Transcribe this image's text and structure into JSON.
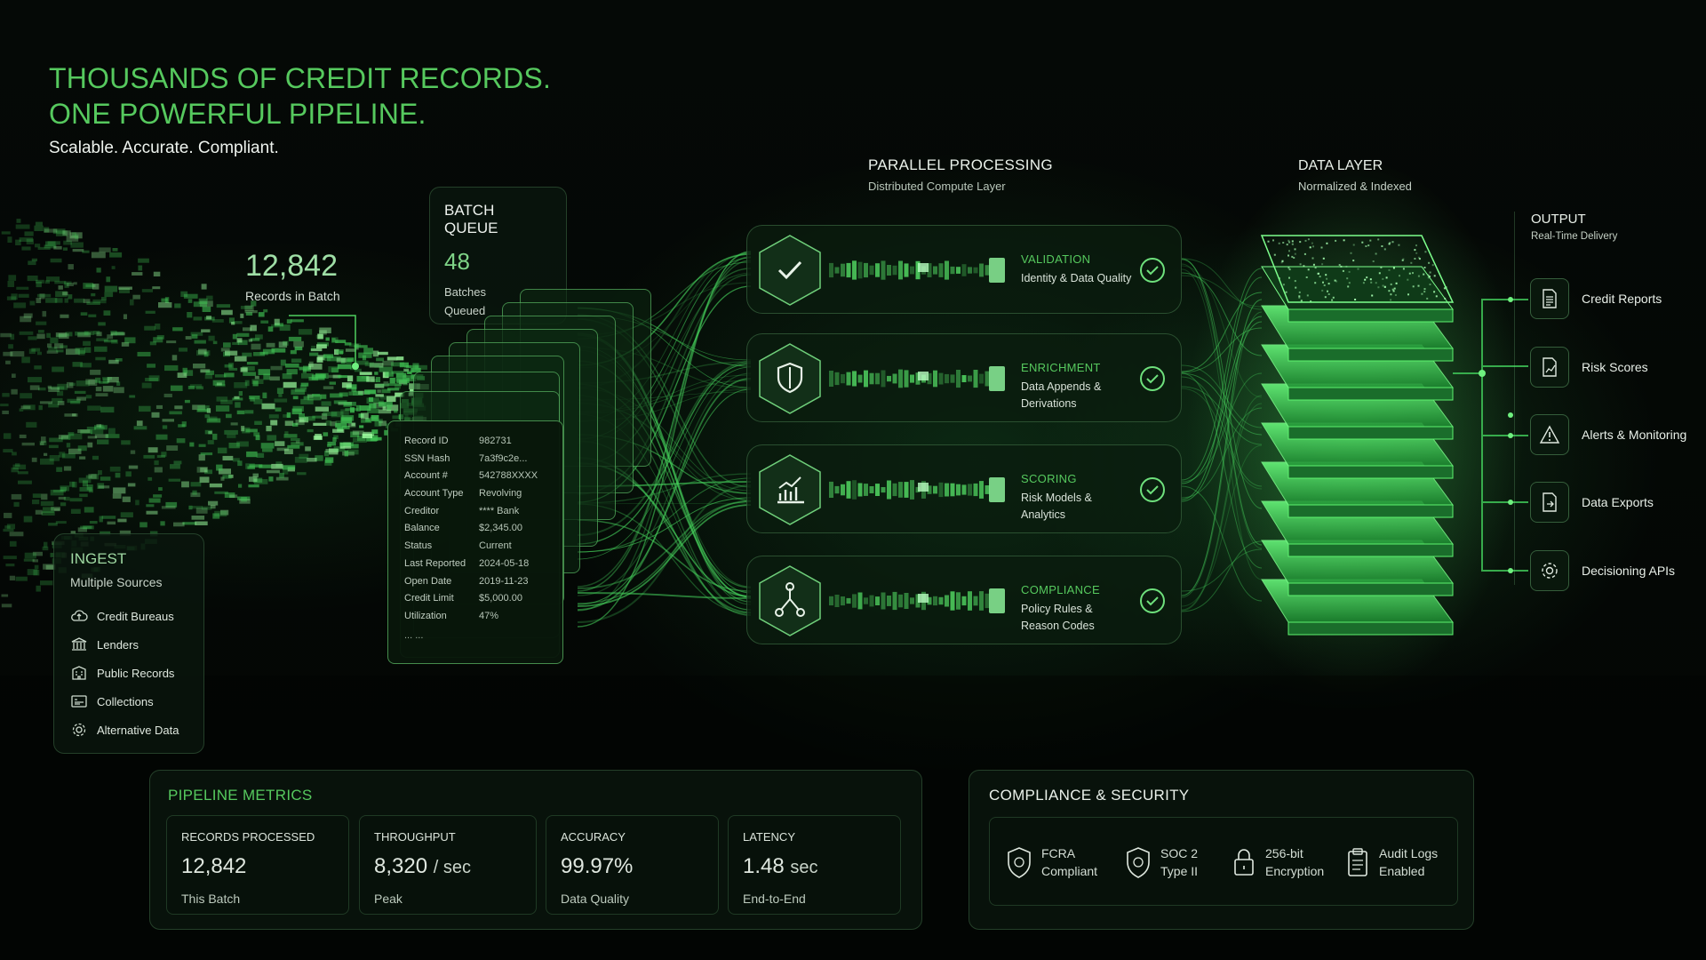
{
  "headline": {
    "line1": "THOUSANDS OF CREDIT RECORDS.",
    "line2": "ONE POWERFUL PIPELINE."
  },
  "tagline": "Scalable. Accurate. Compliant.",
  "records_callout": {
    "value": "12,842",
    "label": "Records in Batch"
  },
  "batch_queue": {
    "title": "BATCH QUEUE",
    "value": "48",
    "label_line1": "Batches",
    "label_line2": "Queued"
  },
  "ingest": {
    "title": "INGEST",
    "subtitle": "Multiple Sources",
    "sources": [
      {
        "label": "Credit Bureaus",
        "icon": "cloud-upload-icon"
      },
      {
        "label": "Lenders",
        "icon": "bank-icon"
      },
      {
        "label": "Public Records",
        "icon": "building-icon"
      },
      {
        "label": "Collections",
        "icon": "folder-icon"
      },
      {
        "label": "Alternative Data",
        "icon": "gear-icon"
      }
    ]
  },
  "record": {
    "fields": [
      {
        "key": "Record ID",
        "value": "982731"
      },
      {
        "key": "SSN Hash",
        "value": "7a3f9c2e..."
      },
      {
        "key": "Account #",
        "value": "542788XXXX"
      },
      {
        "key": "Account Type",
        "value": "Revolving"
      },
      {
        "key": "Creditor",
        "value": "**** Bank"
      },
      {
        "key": "Balance",
        "value": "$2,345.00"
      },
      {
        "key": "Status",
        "value": "Current"
      },
      {
        "key": "Last Reported",
        "value": "2024-05-18"
      },
      {
        "key": "Open Date",
        "value": "2019-11-23"
      },
      {
        "key": "Credit Limit",
        "value": "$5,000.00"
      },
      {
        "key": "Utilization",
        "value": "47%"
      }
    ],
    "ellipsis": "... ..."
  },
  "parallel": {
    "title": "PARALLEL PROCESSING",
    "subtitle": "Distributed Compute Layer",
    "stages": [
      {
        "title": "VALIDATION",
        "sub1": "Identity & Data Quality",
        "sub2": "",
        "icon": "checkmark-icon"
      },
      {
        "title": "ENRICHMENT",
        "sub1": "Data Appends &",
        "sub2": "Derivations",
        "icon": "shield-icon"
      },
      {
        "title": "SCORING",
        "sub1": "Risk Models &",
        "sub2": "Analytics",
        "icon": "chart-icon"
      },
      {
        "title": "COMPLIANCE",
        "sub1": "Policy Rules &",
        "sub2": "Reason Codes",
        "icon": "network-icon"
      }
    ]
  },
  "data_layer": {
    "title": "DATA LAYER",
    "subtitle": "Normalized & Indexed"
  },
  "output": {
    "title": "OUTPUT",
    "subtitle": "Real-Time Delivery",
    "items": [
      {
        "label": "Credit Reports",
        "icon": "document-icon"
      },
      {
        "label": "Risk Scores",
        "icon": "chart-document-icon"
      },
      {
        "label": "Alerts & Monitoring",
        "icon": "alert-icon"
      },
      {
        "label": "Data Exports",
        "icon": "export-icon"
      },
      {
        "label": "Decisioning APIs",
        "icon": "api-gear-icon"
      }
    ]
  },
  "metrics": {
    "title": "PIPELINE METRICS",
    "cards": [
      {
        "label": "RECORDS PROCESSED",
        "value": "12,842",
        "unit": "",
        "foot": "This Batch"
      },
      {
        "label": "THROUGHPUT",
        "value": "8,320",
        "unit": "/ sec",
        "foot": "Peak"
      },
      {
        "label": "ACCURACY",
        "value": "99.97%",
        "unit": "",
        "foot": "Data Quality"
      },
      {
        "label": "LATENCY",
        "value": "1.48",
        "unit": "sec",
        "foot": "End-to-End"
      }
    ]
  },
  "compliance": {
    "title": "COMPLIANCE & SECURITY",
    "items": [
      {
        "line1": "FCRA",
        "line2": "Compliant",
        "icon": "shield-check-icon"
      },
      {
        "line1": "SOC 2",
        "line2": "Type II",
        "icon": "shield-icon"
      },
      {
        "line1": "256-bit",
        "line2": "Encryption",
        "icon": "lock-icon"
      },
      {
        "line1": "Audit Logs",
        "line2": "Enabled",
        "icon": "clipboard-icon"
      }
    ]
  },
  "colors": {
    "accent": "#4fd05f",
    "background": "#040805",
    "panel": "#0a160d"
  }
}
